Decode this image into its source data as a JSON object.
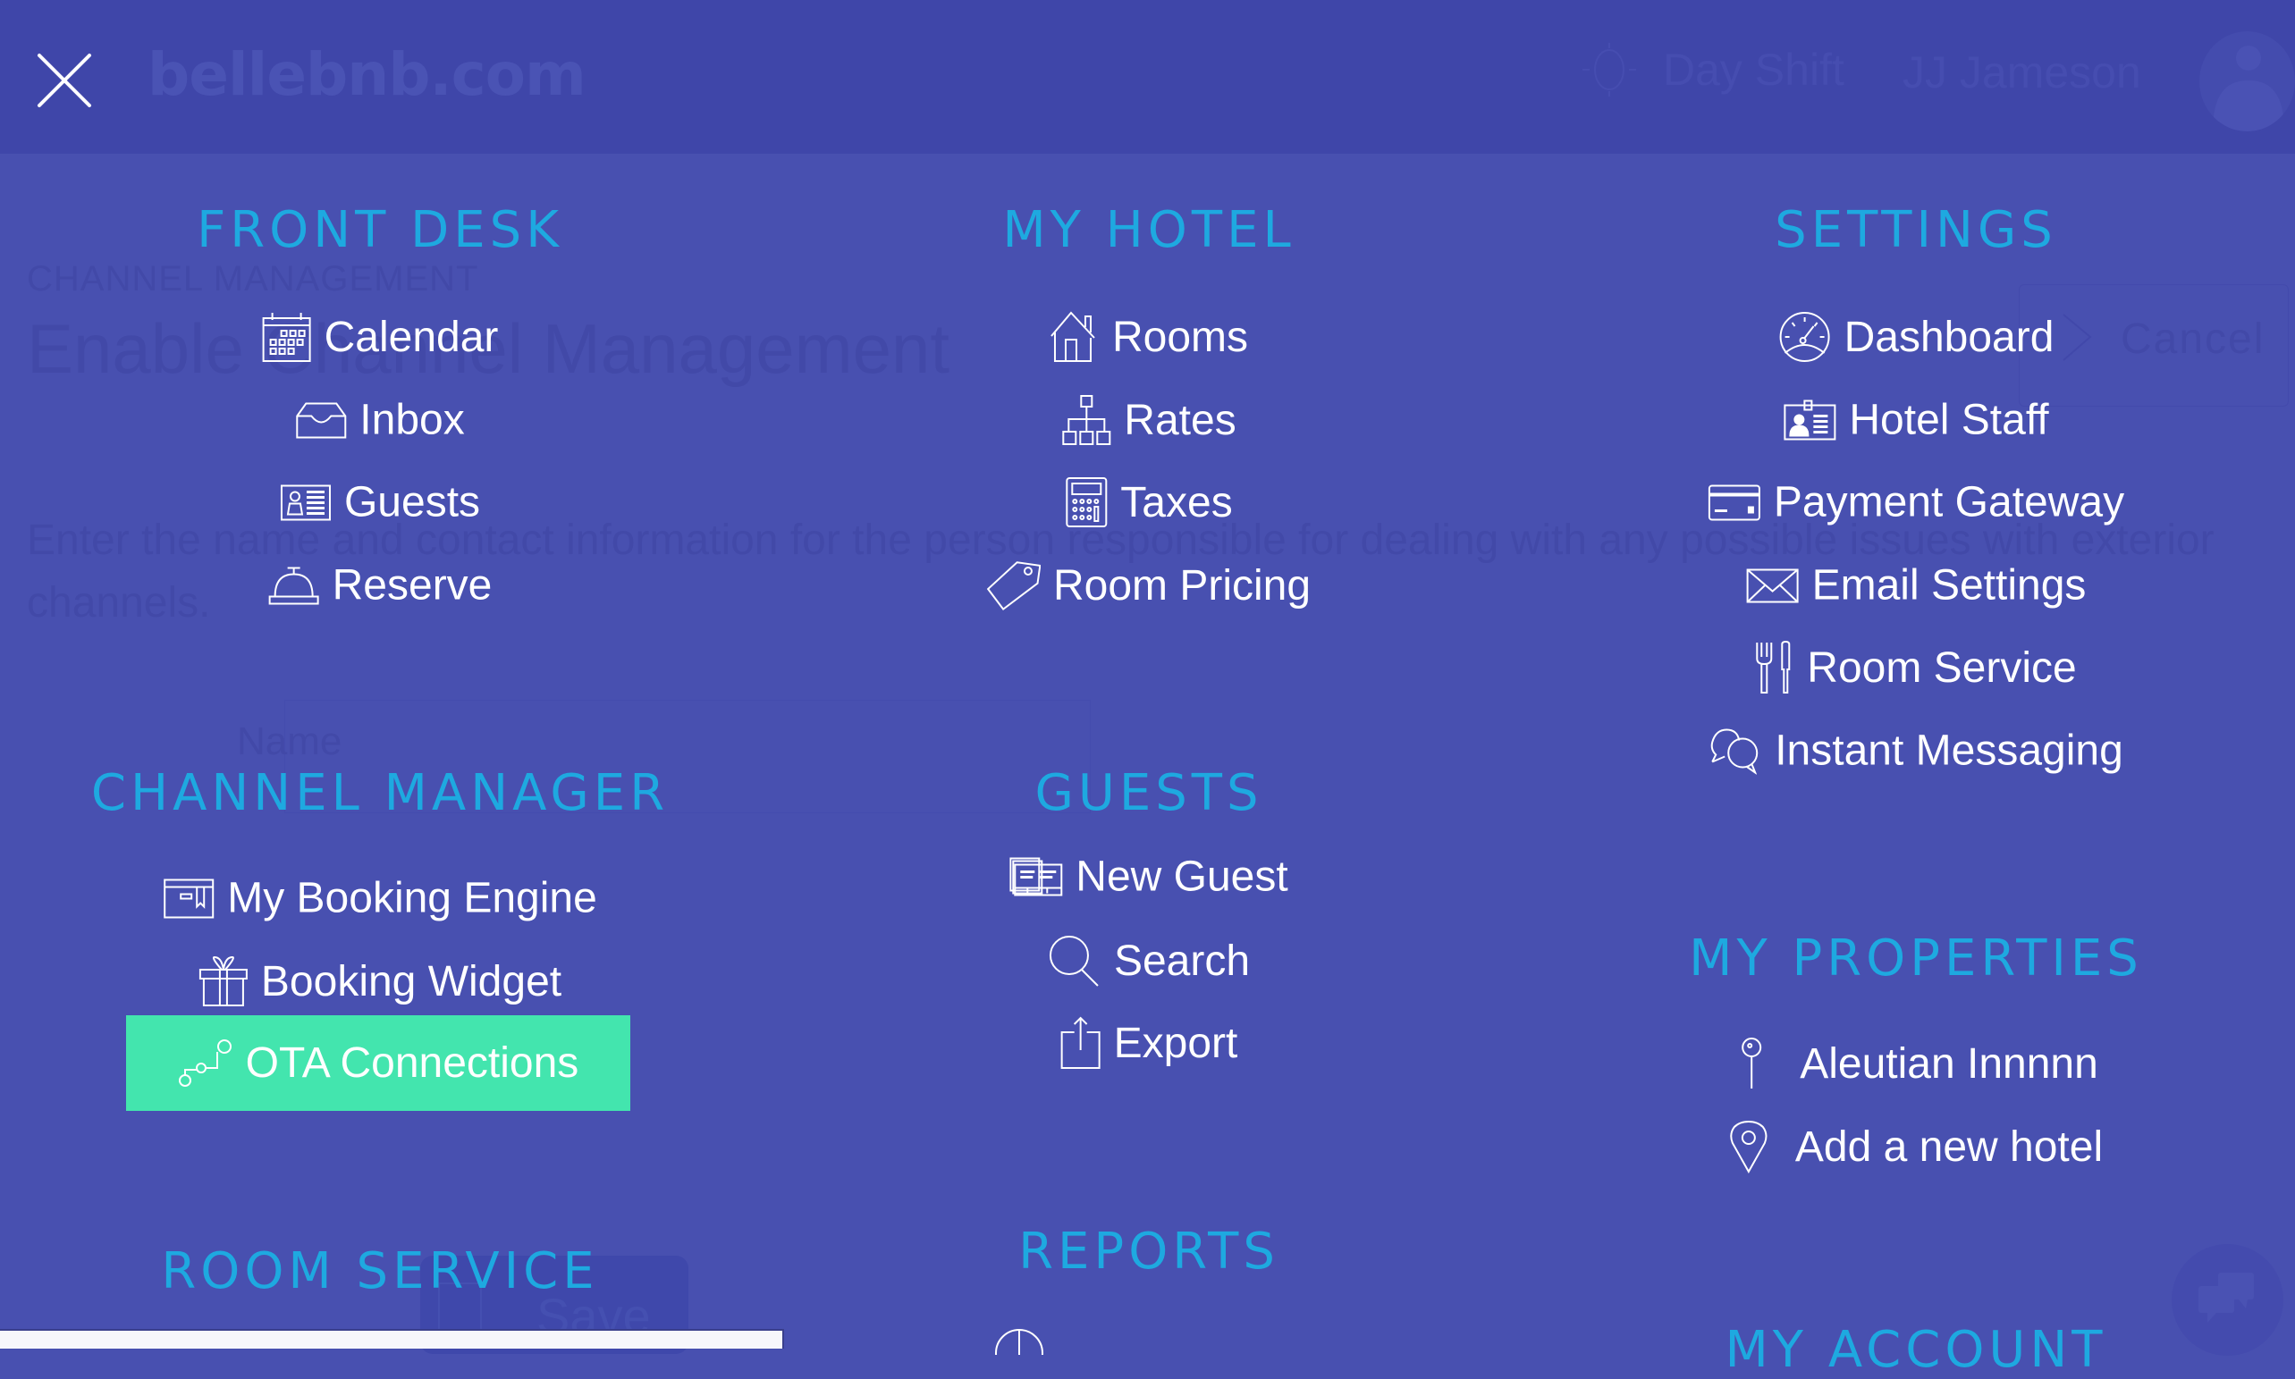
{
  "header": {
    "logo": "bellebnb.com",
    "shift_label": "Day Shift",
    "user_name": "JJ Jameson"
  },
  "background_page": {
    "eyebrow": "CHANNEL MANAGEMENT",
    "title": "Enable Channel Management",
    "description": "Enter the name and contact information for the person responsible for dealing with any possible issues with exterior channels.",
    "name_label": "Name",
    "cancel_label": "Cancel",
    "save_label": "Save"
  },
  "colors": {
    "header_bg": "#3f46a9",
    "overlay_bg": "#4850b0",
    "section_title": "#1ea9e0",
    "active_item_bg": "#43e5ae",
    "item_text": "#ffffff"
  },
  "menu": {
    "front_desk": {
      "title": "FRONT DESK",
      "items": [
        {
          "label": "Calendar",
          "icon": "calendar-icon"
        },
        {
          "label": "Inbox",
          "icon": "inbox-icon"
        },
        {
          "label": "Guests",
          "icon": "guest-card-icon"
        },
        {
          "label": "Reserve",
          "icon": "bell-icon"
        }
      ]
    },
    "channel_manager": {
      "title": "CHANNEL MANAGER",
      "items": [
        {
          "label": "My Booking Engine",
          "icon": "booking-engine-icon"
        },
        {
          "label": "Booking Widget",
          "icon": "gift-icon"
        },
        {
          "label": "OTA Connections",
          "icon": "connections-icon",
          "active": true
        }
      ]
    },
    "room_service": {
      "title": "ROOM SERVICE"
    },
    "my_hotel": {
      "title": "MY HOTEL",
      "items": [
        {
          "label": "Rooms",
          "icon": "house-icon"
        },
        {
          "label": "Rates",
          "icon": "hierarchy-icon"
        },
        {
          "label": "Taxes",
          "icon": "calculator-icon"
        },
        {
          "label": "Room Pricing",
          "icon": "price-tag-icon"
        }
      ]
    },
    "guests": {
      "title": "GUESTS",
      "items": [
        {
          "label": "New Guest",
          "icon": "guest-cards-icon"
        },
        {
          "label": "Search",
          "icon": "search-icon"
        },
        {
          "label": "Export",
          "icon": "export-icon"
        }
      ]
    },
    "reports": {
      "title": "REPORTS"
    },
    "settings": {
      "title": "SETTINGS",
      "items": [
        {
          "label": "Dashboard",
          "icon": "speedometer-icon"
        },
        {
          "label": "Hotel Staff",
          "icon": "staff-badge-icon"
        },
        {
          "label": "Payment Gateway",
          "icon": "credit-card-icon"
        },
        {
          "label": "Email Settings",
          "icon": "envelope-icon"
        },
        {
          "label": "Room Service",
          "icon": "fork-knife-icon"
        },
        {
          "label": "Instant Messaging",
          "icon": "chat-bubbles-icon"
        }
      ]
    },
    "my_properties": {
      "title": "MY PROPERTIES",
      "items": [
        {
          "label": "Aleutian Innnnn",
          "icon": "pin-icon"
        },
        {
          "label": "Add a new hotel",
          "icon": "location-marker-icon"
        }
      ]
    },
    "my_account": {
      "title": "MY ACCOUNT"
    }
  }
}
